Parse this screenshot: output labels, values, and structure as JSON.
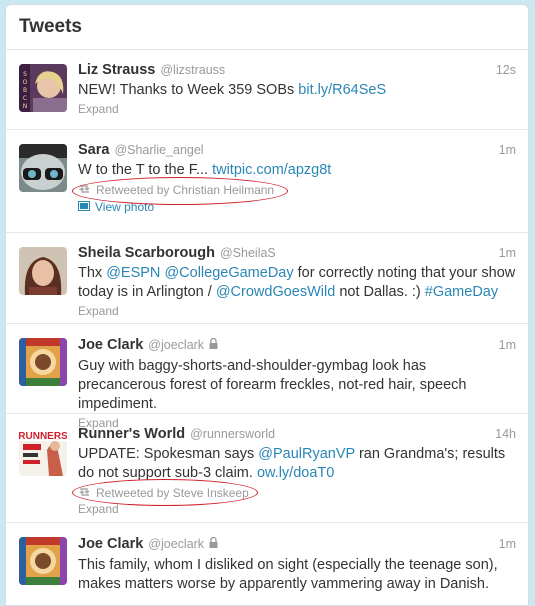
{
  "header": {
    "title": "Tweets"
  },
  "tweets": [
    {
      "name": "Liz Strauss",
      "handle": "@lizstrauss",
      "time": "12s",
      "text_pre": "NEW! Thanks to Week 359 SOBs ",
      "link1": "bit.ly/R64SeS",
      "expand": "Expand",
      "protected": false
    },
    {
      "name": "Sara",
      "handle": "@Sharlie_angel",
      "time": "1m",
      "text_pre": "W to the T to the F... ",
      "link1": "twitpic.com/apzg8t",
      "retweeted_by": "Retweeted by Christian Heilmann",
      "view_photo": "View photo",
      "protected": false
    },
    {
      "name": "Sheila Scarborough",
      "handle": "@SheilaS",
      "time": "1m",
      "p1": "Thx ",
      "m1": "@ESPN",
      "p2": " ",
      "m2": "@CollegeGameDay",
      "p3": " for correctly noting that your show today is in Arlington / ",
      "m3": "@CrowdGoesWild",
      "p4": " not Dallas. :) ",
      "m4": "#GameDay",
      "expand": "Expand",
      "protected": false
    },
    {
      "name": "Joe Clark",
      "handle": "@joeclark",
      "time": "1m",
      "text": "Guy with baggy-shorts-and-shoulder-gymbag look has precancerous forest of forearm freckles, not-red hair, speech impediment.",
      "expand": "Expand",
      "protected": true
    },
    {
      "name": "Runner's World",
      "handle": "@runnersworld",
      "time": "14h",
      "p1": "UPDATE: Spokesman says ",
      "m1": "@PaulRyanVP",
      "p2": " ran Grandma's; results do not support sub-3 claim. ",
      "m2": "ow.ly/doaT0",
      "retweeted_by": "Retweeted by Steve Inskeep",
      "expand": "Expand",
      "protected": false,
      "avatar_text": "RUNNERS"
    },
    {
      "name": "Joe Clark",
      "handle": "@joeclark",
      "time": "1m",
      "text": "This family, whom I disliked on sight (especially the teenage son), makes matters worse by apparently vammering away in Danish.",
      "protected": true
    }
  ],
  "colors": {
    "link": "#2a86b5",
    "muted": "#999999",
    "annotation": "#d0202a",
    "background": "#c9e8ef"
  }
}
